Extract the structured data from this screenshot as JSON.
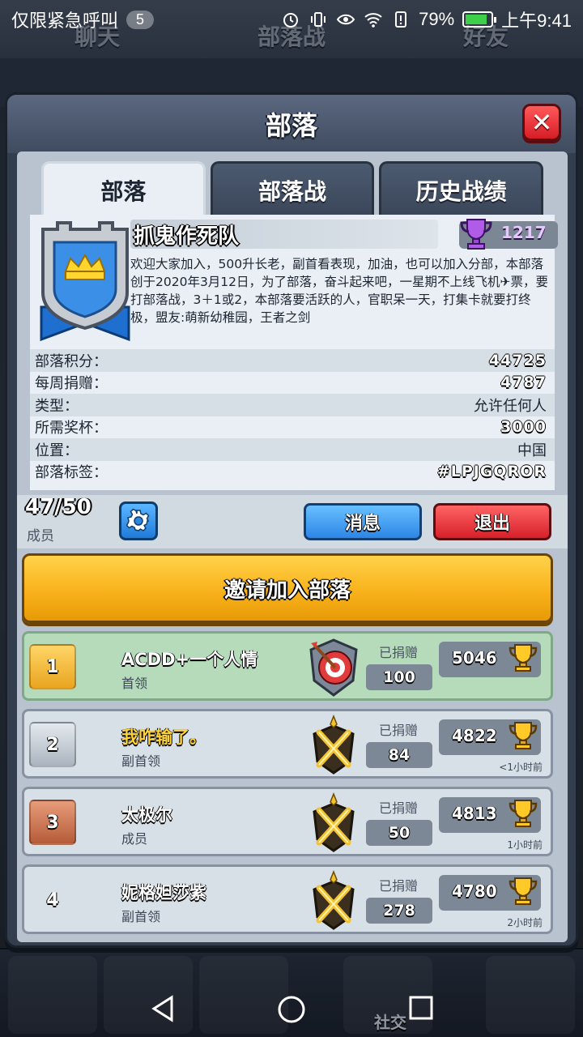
{
  "status_bar": {
    "notification_text": "仅限紧急呼叫",
    "notification_count": "5",
    "battery": "79%",
    "time": "上午9:41"
  },
  "background": {
    "tabs": [
      "聊天",
      "部落战",
      "好友"
    ],
    "clan_label": "抓鬼作死队",
    "nav_label": "社交"
  },
  "modal": {
    "title": "部落",
    "tabs": [
      {
        "label": "部落",
        "active": true
      },
      {
        "label": "部落战",
        "active": false
      },
      {
        "label": "历史战绩",
        "active": false
      }
    ]
  },
  "clan": {
    "name": "抓鬼作死队",
    "trophies": "1217",
    "description": "欢迎大家加入，500升长老，副首看表现，加油，也可以加入分部，本部落创于2020年3月12日，为了部落，奋斗起来吧，一星期不上线飞机✈票，要打部落战，3＋1或2，本部落要活跃的人，官职呆一天，打集卡就要打终极，盟友:萌新幼稚园，王者之剑",
    "stats": [
      {
        "label": "部落积分：",
        "value": "44725",
        "style": "outline"
      },
      {
        "label": "每周捐赠：",
        "value": "4787",
        "style": "outline"
      },
      {
        "label": "类型：",
        "value": "允许任何人",
        "style": "plain"
      },
      {
        "label": "所需奖杯：",
        "value": "3000",
        "style": "outline"
      },
      {
        "label": "位置：",
        "value": "中国",
        "style": "plain"
      },
      {
        "label": "部落标签：",
        "value": "#LPJGQROR",
        "style": "outline"
      }
    ]
  },
  "members_bar": {
    "count": "47/50",
    "count_label": "成员",
    "message_button": "消息",
    "leave_button": "退出"
  },
  "invite_button": "邀请加入部落",
  "donated_label": "已捐赠",
  "members": [
    {
      "rank": "1",
      "name": "ACDD+一个人情",
      "role": "首领",
      "donated": "100",
      "trophies": "5046",
      "last_seen": "",
      "rank_style": "gold",
      "self": true,
      "name_gold": false
    },
    {
      "rank": "2",
      "name": "我咋输了。",
      "role": "副首领",
      "donated": "84",
      "trophies": "4822",
      "last_seen": "<1小时前",
      "rank_style": "silver",
      "self": false,
      "name_gold": true
    },
    {
      "rank": "3",
      "name": "太极尔",
      "role": "成员",
      "donated": "50",
      "trophies": "4813",
      "last_seen": "1小时前",
      "rank_style": "bronze",
      "self": false,
      "name_gold": false
    },
    {
      "rank": "4",
      "name": "妮格妲莎紫",
      "role": "副首领",
      "donated": "278",
      "trophies": "4780",
      "last_seen": "2小时前",
      "rank_style": "plain",
      "self": false,
      "name_gold": false
    }
  ],
  "colors": {
    "invite_gold": "#f9b21c",
    "message_blue": "#2d86e6",
    "leave_red": "#d7202a",
    "self_row_green": "#b6dbbb"
  }
}
